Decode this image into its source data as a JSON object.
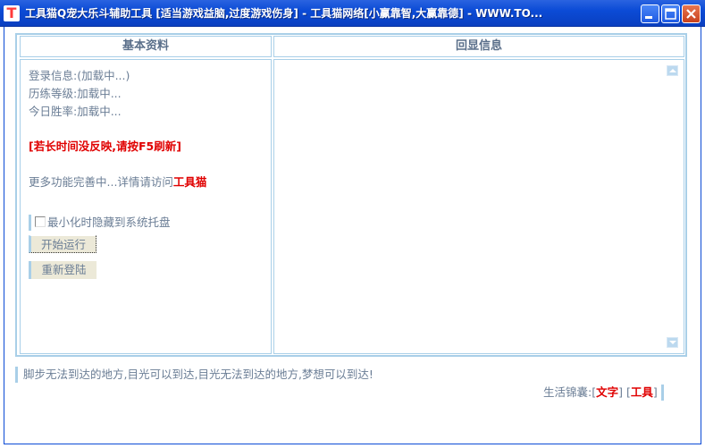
{
  "window": {
    "title": "工具猫Q宠大乐斗辅助工具 [适当游戏益脑,过度游戏伤身] - 工具猫网络[小赢靠智,大赢靠德] - WWW.TO...",
    "app_icon_letter": "T"
  },
  "headers": {
    "left": "基本资料",
    "right": "回显信息"
  },
  "info": {
    "login": "登录信息:(加载中...)",
    "level": "历练等级:加载中...",
    "winrate": "今日胜率:加载中..."
  },
  "warning": "[若长时间没反映,请按F5刷新]",
  "more": {
    "prefix": "更多功能完善中...详情请访问",
    "link": "工具猫"
  },
  "options": {
    "minimize_to_tray": "最小化时隐藏到系统托盘"
  },
  "buttons": {
    "start": "开始运行",
    "relogin": "重新登陆"
  },
  "motto": "脚步无法到达的地方,目光可以到达,目光无法到达的地方,梦想可以到达!",
  "footer": {
    "prefix": "生活锦囊:",
    "lb1": "[",
    "link1": "文字",
    "rb1": "]",
    "lb2": "[",
    "link2": "工具",
    "rb2": "]"
  }
}
